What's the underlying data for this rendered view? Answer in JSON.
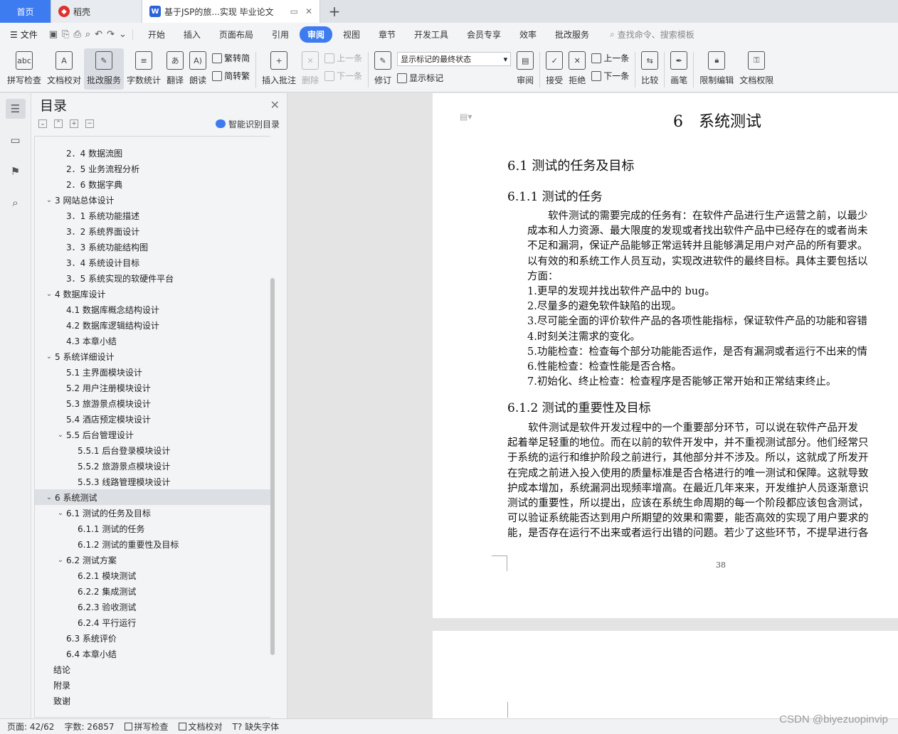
{
  "tabs": {
    "home": "首页",
    "daoke": "稻壳",
    "doc": "基于JSP的旅...实现 毕业论文",
    "add": "+"
  },
  "menu": {
    "file": "文件",
    "items": [
      "开始",
      "插入",
      "页面布局",
      "引用",
      "审阅",
      "视图",
      "章节",
      "开发工具",
      "会员专享",
      "效率",
      "批改服务"
    ],
    "active": "审阅",
    "search": "查找命令、搜索模板"
  },
  "ribbon": {
    "spell": "拼写检查",
    "proof": "文档校对",
    "grade": "批改服务",
    "wordcount": "字数统计",
    "translate": "翻译",
    "read": "朗读",
    "to_trad": "繁转简",
    "to_simp": "简转繁",
    "insert_comment": "插入批注",
    "delete": "删除",
    "prev": "上一条",
    "next": "下一条",
    "track": "修订",
    "state": "显示标记的最终状态",
    "show_marks": "显示标记",
    "review": "审阅",
    "accept": "接受",
    "reject": "拒绝",
    "prev2": "上一条",
    "next2": "下一条",
    "compare": "比较",
    "pen": "画笔",
    "restrict": "限制编辑",
    "rights": "文档权限"
  },
  "toc": {
    "title": "目录",
    "smart": "智能识别目录",
    "items": [
      {
        "label": "2．4 数据流图",
        "level": 2
      },
      {
        "label": "2．5 业务流程分析",
        "level": 2
      },
      {
        "label": "2．6 数据字典",
        "level": 2
      },
      {
        "label": "3 网站总体设计",
        "level": 1,
        "open": true
      },
      {
        "label": "3．1 系统功能描述",
        "level": 2
      },
      {
        "label": "3．2 系统界面设计",
        "level": 2
      },
      {
        "label": "3．3 系统功能结构图",
        "level": 2
      },
      {
        "label": "3．4 系统设计目标",
        "level": 2
      },
      {
        "label": "3．5 系统实现的软硬件平台",
        "level": 2
      },
      {
        "label": "4 数据库设计",
        "level": 1,
        "open": true
      },
      {
        "label": "4.1 数据库概念结构设计",
        "level": 2
      },
      {
        "label": "4.2 数据库逻辑结构设计",
        "level": 2
      },
      {
        "label": "4.3 本章小结",
        "level": 2
      },
      {
        "label": "5 系统详细设计",
        "level": 1,
        "open": true
      },
      {
        "label": "5.1 主界面模块设计",
        "level": 2
      },
      {
        "label": "5.2 用户注册模块设计",
        "level": 2
      },
      {
        "label": "5.3 旅游景点模块设计",
        "level": 2
      },
      {
        "label": "5.4 酒店预定模块设计",
        "level": 2
      },
      {
        "label": "5.5 后台管理设计",
        "level": 2,
        "open": true
      },
      {
        "label": "5.5.1 后台登录模块设计",
        "level": 3
      },
      {
        "label": "5.5.2 旅游景点模块设计",
        "level": 3
      },
      {
        "label": "5.5.3 线路管理模块设计",
        "level": 3
      },
      {
        "label": "6 系统测试",
        "level": 1,
        "open": true,
        "selected": true
      },
      {
        "label": "6.1 测试的任务及目标",
        "level": 2,
        "open": true
      },
      {
        "label": "6.1.1 测试的任务",
        "level": 3
      },
      {
        "label": "6.1.2 测试的重要性及目标",
        "level": 3
      },
      {
        "label": "6.2 测试方案",
        "level": 2,
        "open": true
      },
      {
        "label": "6.2.1 模块测试",
        "level": 3
      },
      {
        "label": "6.2.2 集成测试",
        "level": 3
      },
      {
        "label": "6.2.3 验收测试",
        "level": 3
      },
      {
        "label": "6.2.4 平行运行",
        "level": 3
      },
      {
        "label": "6.3 系统评价",
        "level": 2
      },
      {
        "label": "6.4 本章小结",
        "level": 2
      },
      {
        "label": "结论",
        "level": 0
      },
      {
        "label": "附录",
        "level": 0
      },
      {
        "label": "致谢",
        "level": 0
      }
    ]
  },
  "doc": {
    "h1": "6　系统测试",
    "h2_1": "6.1 测试的任务及目标",
    "h3_1": "6.1.1 测试的任务",
    "p1": [
      "　　软件测试的需要完成的任务有：在软件产品进行生产运营之前，以最少",
      "成本和人力资源、最大限度的发现或者找出软件产品中已经存在的或者尚未",
      "不足和漏洞，保证产品能够正常运转并且能够满足用户对产品的所有要求。",
      "以有效的和系统工作人员互动，实现改进软件的最终目标。具体主要包括以",
      "方面："
    ],
    "list": [
      "1.更早的发现并找出软件产品中的 bug。",
      "2.尽量多的避免软件缺陷的出现。",
      "3.尽可能全面的评价软件产品的各项性能指标，保证软件产品的功能和容错",
      "4.时刻关注需求的变化。",
      "5.功能检查：检查每个部分功能能否运作，是否有漏洞或者运行不出来的情",
      "6.性能检查：检查性能是否合格。",
      "7.初始化、终止检查：检查程序是否能够正常开始和正常结束终止。"
    ],
    "h3_2": "6.1.2 测试的重要性及目标",
    "p2": [
      "　　软件测试是软件开发过程中的一个重要部分环节，可以说在软件产品开发",
      "起着举足轻重的地位。而在以前的软件开发中，并不重视测试部分。他们经常只",
      "于系统的运行和维护阶段之前进行，其他部分并不涉及。所以，这就成了所发开",
      "在完成之前进入投入使用的质量标准是否合格进行的唯一测试和保障。这就导致",
      "护成本增加，系统漏洞出现频率增高。在最近几年来来，开发维护人员逐渐意识",
      "测试的重要性，所以提出，应该在系统生命周期的每一个阶段都应该包含测试，",
      "可以验证系统能否达到用户所期望的效果和需要，能否高效的实现了用户要求的",
      "能，是否存在运行不出来或者运行出错的问题。若少了这些环节，不提早进行各"
    ],
    "page_number": "38"
  },
  "status": {
    "page": "页面: 42/62",
    "words": "字数: 26857",
    "spell": "拼写检查",
    "proof": "文档校对",
    "font": "缺失字体"
  },
  "watermark": "CSDN @biyezuopinvip",
  "colors": {
    "accent": "#3c7bf0",
    "selected_bg": "#dcdfe3"
  }
}
